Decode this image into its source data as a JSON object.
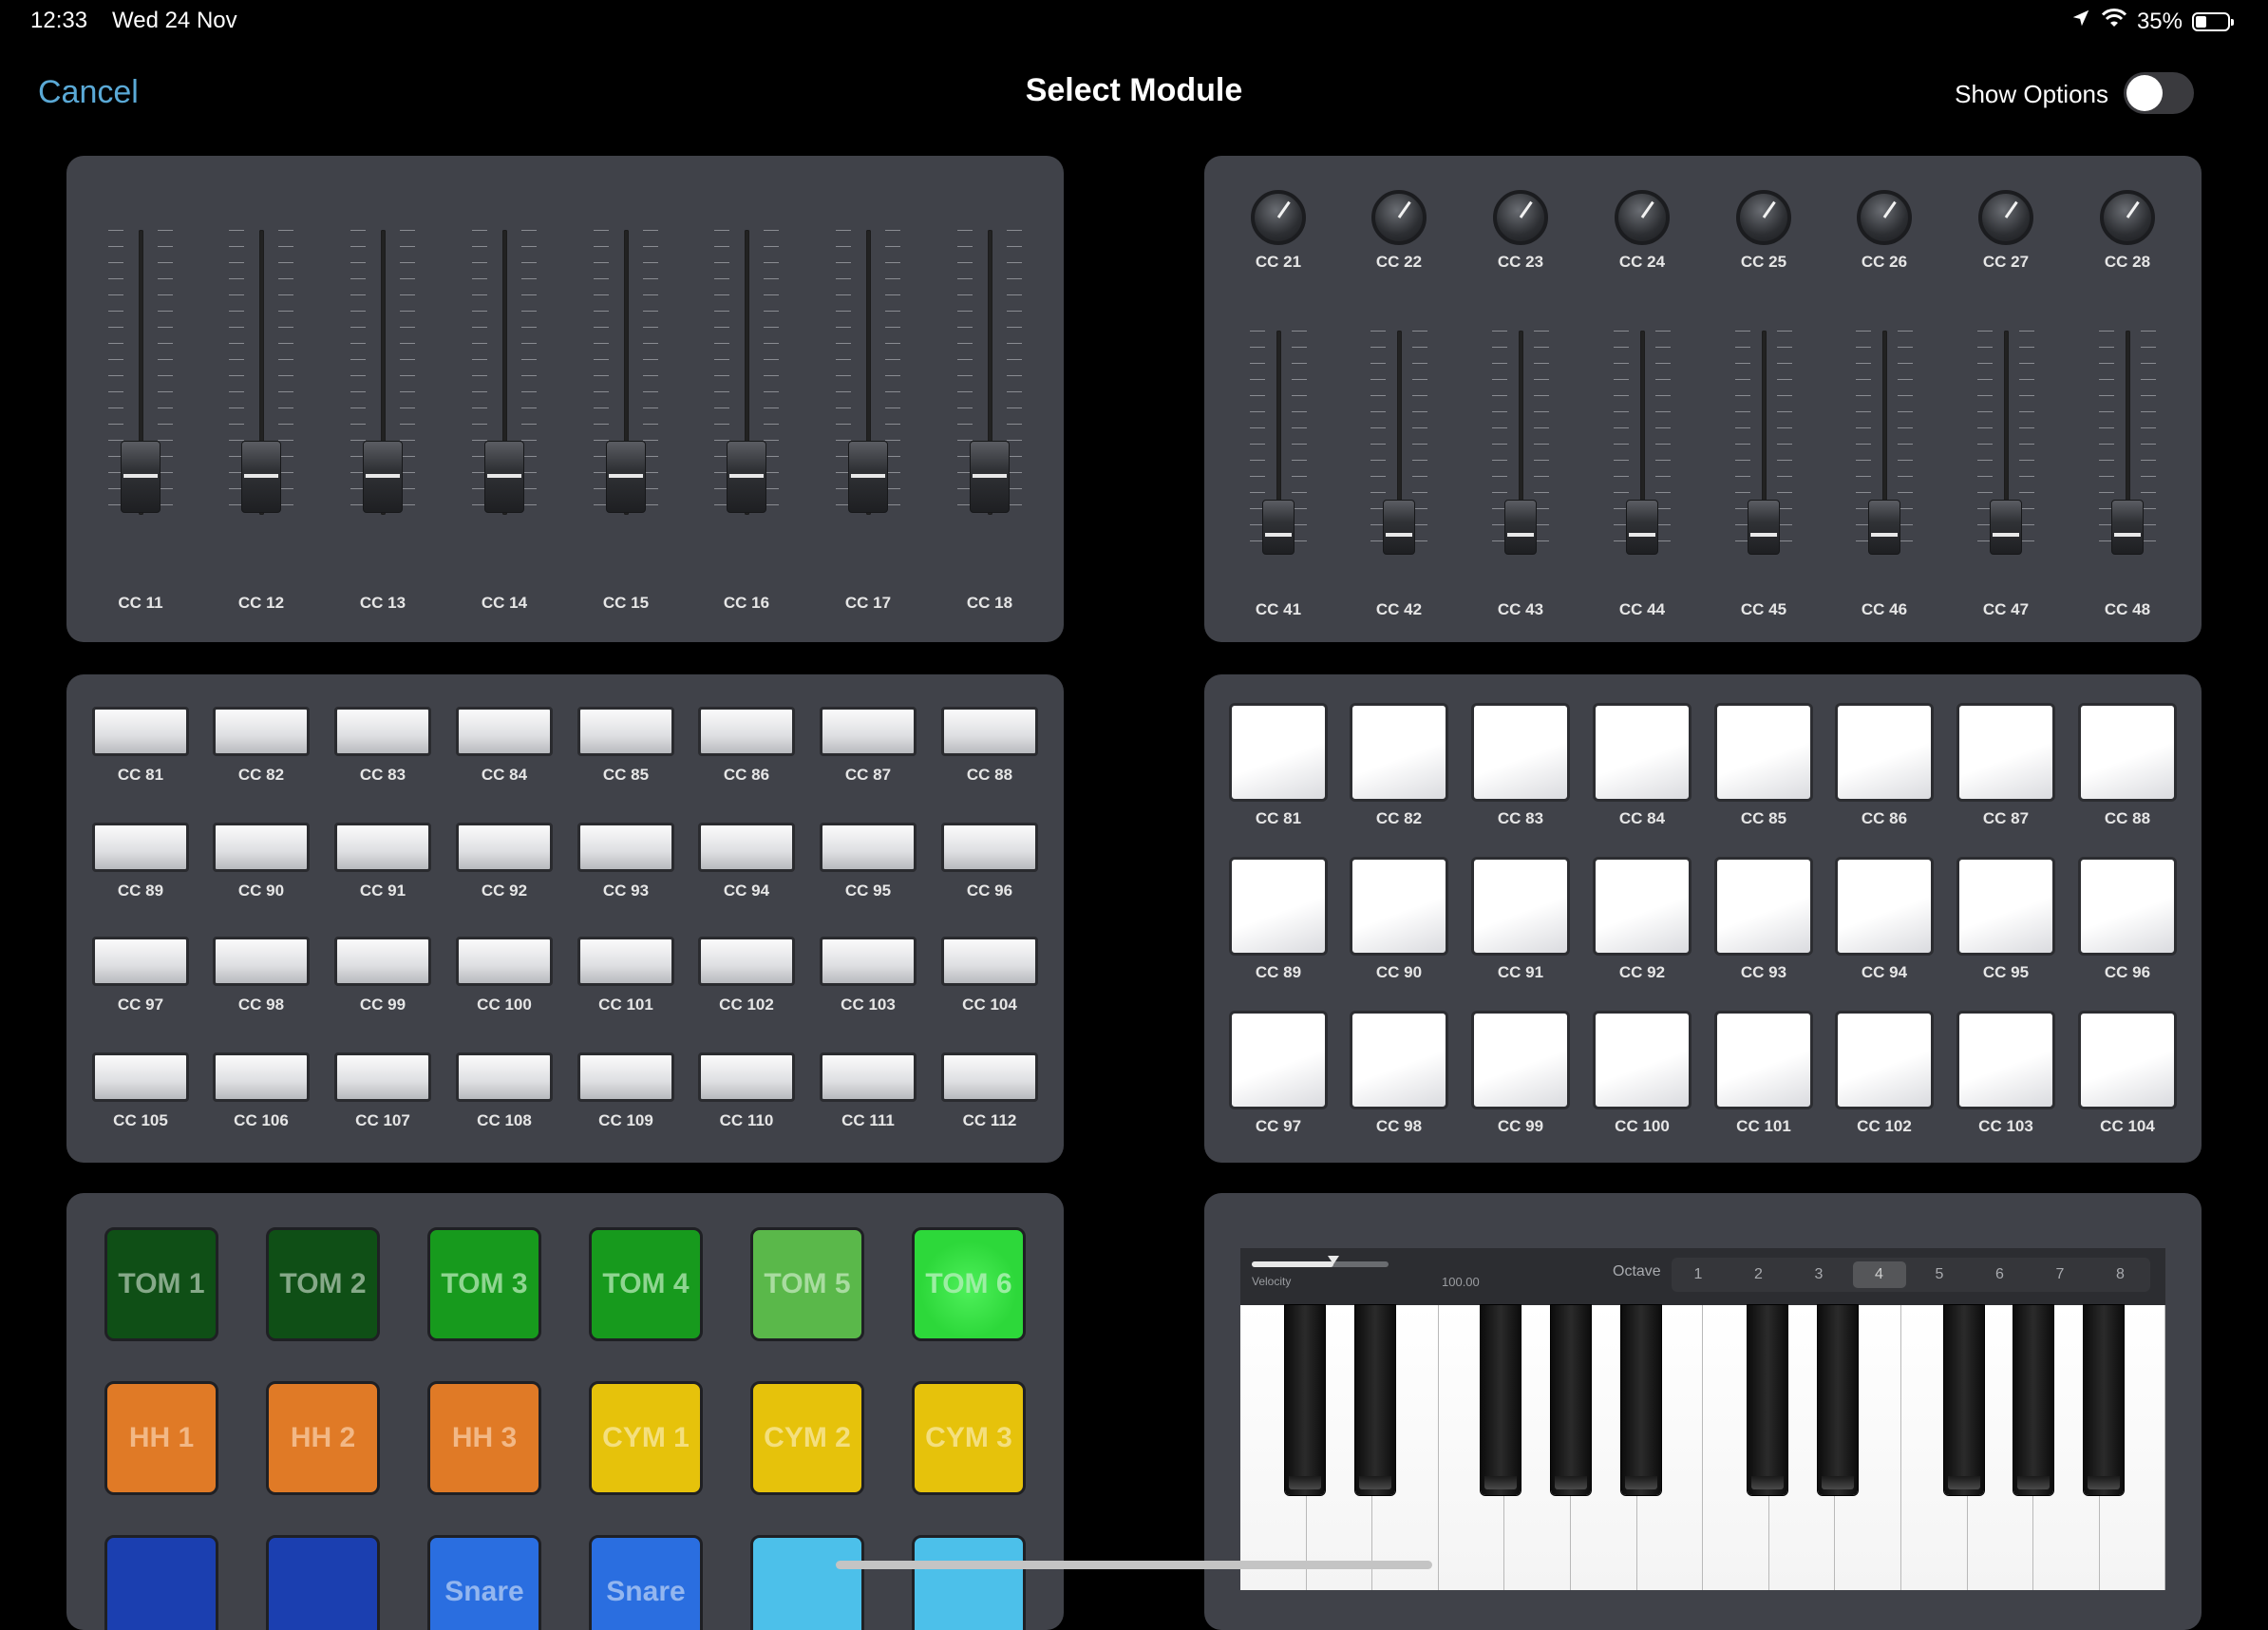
{
  "status_bar": {
    "time": "12:33",
    "date": "Wed 24 Nov",
    "battery": "35%",
    "battery_level": 0.35
  },
  "nav": {
    "cancel": "Cancel",
    "title": "Select Module",
    "show_options": "Show Options",
    "show_options_on": false
  },
  "fader_module": {
    "labels": [
      "CC 11",
      "CC 12",
      "CC 13",
      "CC 14",
      "CC 15",
      "CC 16",
      "CC 17",
      "CC 18"
    ]
  },
  "knob_fader_module": {
    "knob_labels": [
      "CC 21",
      "CC 22",
      "CC 23",
      "CC 24",
      "CC 25",
      "CC 26",
      "CC 27",
      "CC 28"
    ],
    "fader_labels": [
      "CC 41",
      "CC 42",
      "CC 43",
      "CC 44",
      "CC 45",
      "CC 46",
      "CC 47",
      "CC 48"
    ]
  },
  "button_module": {
    "labels": [
      [
        "CC 81",
        "CC 82",
        "CC 83",
        "CC 84",
        "CC 85",
        "CC 86",
        "CC 87",
        "CC 88"
      ],
      [
        "CC 89",
        "CC 90",
        "CC 91",
        "CC 92",
        "CC 93",
        "CC 94",
        "CC 95",
        "CC 96"
      ],
      [
        "CC 97",
        "CC 98",
        "CC 99",
        "CC 100",
        "CC 101",
        "CC 102",
        "CC 103",
        "CC 104"
      ],
      [
        "CC 105",
        "CC 106",
        "CC 107",
        "CC 108",
        "CC 109",
        "CC 110",
        "CC 111",
        "CC 112"
      ]
    ]
  },
  "pad_module": {
    "labels": [
      [
        "CC 81",
        "CC 82",
        "CC 83",
        "CC 84",
        "CC 85",
        "CC 86",
        "CC 87",
        "CC 88"
      ],
      [
        "CC 89",
        "CC 90",
        "CC 91",
        "CC 92",
        "CC 93",
        "CC 94",
        "CC 95",
        "CC 96"
      ],
      [
        "CC 97",
        "CC 98",
        "CC 99",
        "CC 100",
        "CC 101",
        "CC 102",
        "CC 103",
        "CC 104"
      ]
    ]
  },
  "drum_module": {
    "rows": [
      [
        {
          "label": "TOM 1",
          "color": "#0f4f16",
          "text": "#86a989"
        },
        {
          "label": "TOM 2",
          "color": "#0f4f16",
          "text": "#86a989"
        },
        {
          "label": "TOM 3",
          "color": "#179a1d",
          "text": "#8fd591"
        },
        {
          "label": "TOM 4",
          "color": "#179a1d",
          "text": "#8fd591"
        },
        {
          "label": "TOM 5",
          "color": "#5ab84a",
          "text": "#a9dca0"
        },
        {
          "label": "TOM 6",
          "color": "#2dd83a",
          "text": "#9ceea3"
        }
      ],
      [
        {
          "label": "HH 1",
          "color": "#e07a26",
          "text": "#f2b886"
        },
        {
          "label": "HH 2",
          "color": "#e07a26",
          "text": "#f2b886"
        },
        {
          "label": "HH 3",
          "color": "#e07a26",
          "text": "#f2b886"
        },
        {
          "label": "CYM 1",
          "color": "#e6c20b",
          "text": "#f4df7e"
        },
        {
          "label": "CYM 2",
          "color": "#e6c20b",
          "text": "#f4df7e"
        },
        {
          "label": "CYM 3",
          "color": "#e6c20b",
          "text": "#f4df7e"
        }
      ],
      [
        {
          "label": "",
          "color": "#1b3fb0",
          "text": "#7f96d6"
        },
        {
          "label": "",
          "color": "#1b3fb0",
          "text": "#7f96d6"
        },
        {
          "label": "Snare",
          "color": "#2a6ee0",
          "text": "#93b6ef"
        },
        {
          "label": "Snare",
          "color": "#2a6ee0",
          "text": "#93b6ef"
        },
        {
          "label": "",
          "color": "#4cc0ea",
          "text": "#a6def3"
        },
        {
          "label": "",
          "color": "#4cc0ea",
          "text": "#a6def3"
        }
      ]
    ]
  },
  "keyboard_module": {
    "velocity_label": "Velocity",
    "velocity_value": "100.00",
    "velocity_level": 0.6,
    "octave_label": "Octave",
    "octaves": [
      "1",
      "2",
      "3",
      "4",
      "5",
      "6",
      "7",
      "8"
    ],
    "selected_octave": "4"
  }
}
